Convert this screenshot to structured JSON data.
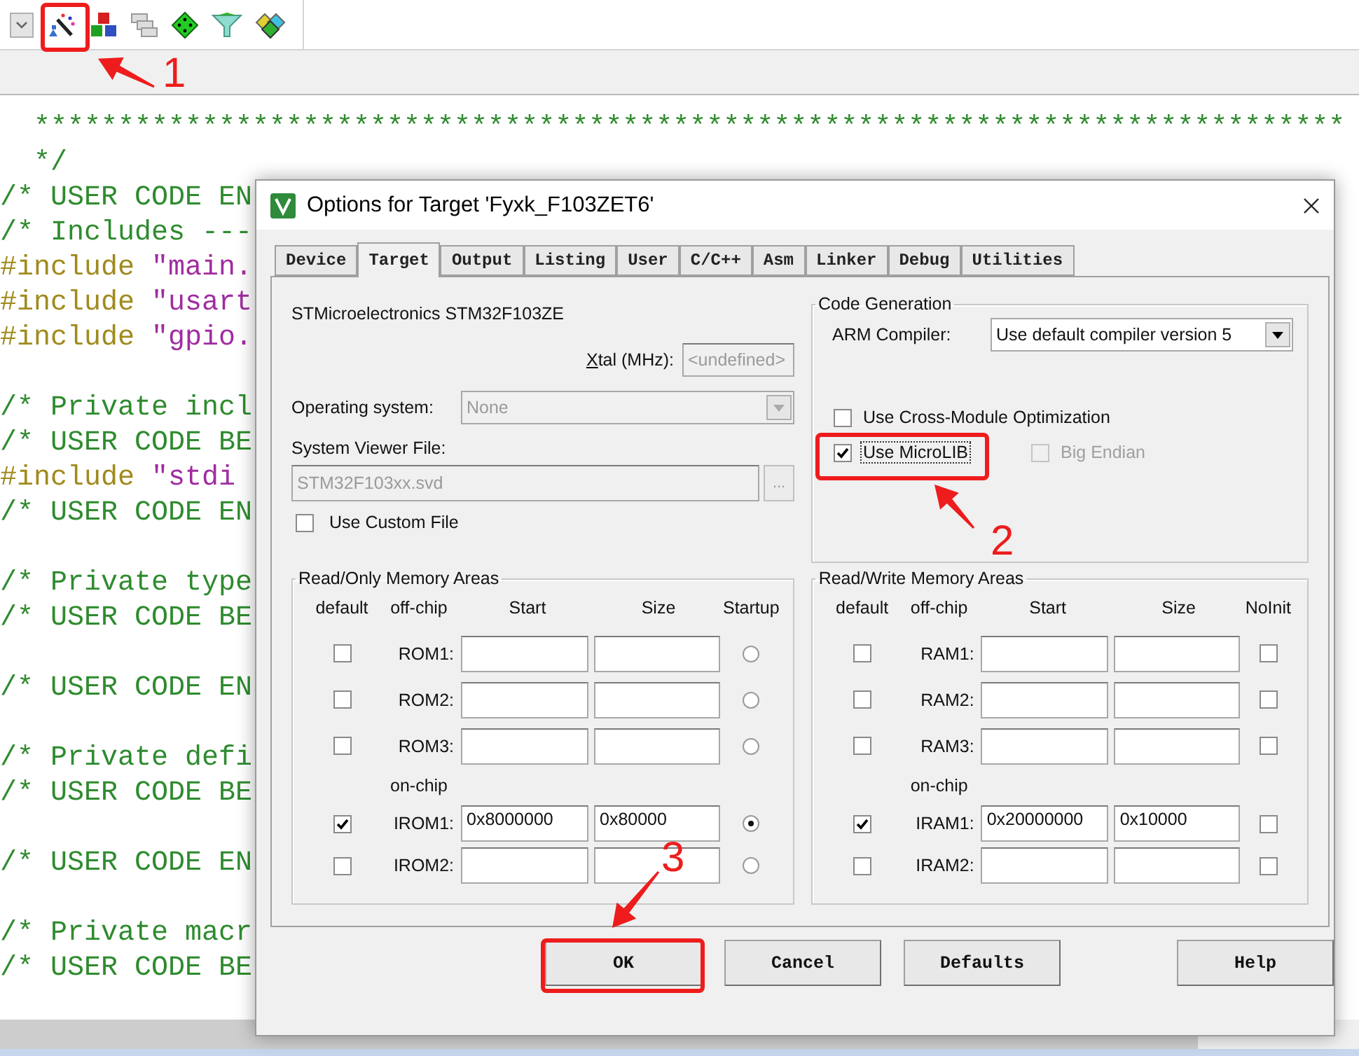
{
  "editor": {
    "lines": [
      {
        "kind": "comment",
        "text": "  ******************************************************************************"
      },
      {
        "kind": "comment",
        "text": "  */"
      },
      {
        "kind": "comment",
        "text": "/* USER CODE EN"
      },
      {
        "kind": "comment",
        "text": "/* Includes ---"
      },
      {
        "kind": "include",
        "directive": "#include ",
        "string": "\"main."
      },
      {
        "kind": "include",
        "directive": "#include ",
        "string": "\"usart"
      },
      {
        "kind": "include",
        "directive": "#include ",
        "string": "\"gpio."
      },
      {
        "kind": "blank"
      },
      {
        "kind": "comment",
        "text": "/* Private incl"
      },
      {
        "kind": "comment",
        "text": "/* USER CODE BE"
      },
      {
        "kind": "include",
        "directive": "#include ",
        "string": "\"stdi"
      },
      {
        "kind": "comment",
        "text": "/* USER CODE EN"
      },
      {
        "kind": "blank"
      },
      {
        "kind": "comment",
        "text": "/* Private type"
      },
      {
        "kind": "comment",
        "text": "/* USER CODE BE"
      },
      {
        "kind": "blank"
      },
      {
        "kind": "comment",
        "text": "/* USER CODE EN"
      },
      {
        "kind": "blank"
      },
      {
        "kind": "comment",
        "text": "/* Private defi"
      },
      {
        "kind": "comment",
        "text": "/* USER CODE BE"
      },
      {
        "kind": "blank"
      },
      {
        "kind": "comment",
        "text": "/* USER CODE EN"
      },
      {
        "kind": "blank"
      },
      {
        "kind": "comment",
        "text": "/* Private macr"
      },
      {
        "kind": "comment",
        "text": "/* USER CODE BE"
      }
    ]
  },
  "dialog": {
    "title": "Options for Target 'Fyxk_F103ZET6'",
    "tabs": [
      {
        "label": "Device",
        "selected": false
      },
      {
        "label": "Target",
        "selected": true
      },
      {
        "label": "Output",
        "selected": false
      },
      {
        "label": "Listing",
        "selected": false
      },
      {
        "label": "User",
        "selected": false
      },
      {
        "label": "C/C++",
        "selected": false
      },
      {
        "label": "Asm",
        "selected": false
      },
      {
        "label": "Linker",
        "selected": false
      },
      {
        "label": "Debug",
        "selected": false
      },
      {
        "label": "Utilities",
        "selected": false
      }
    ],
    "device": "STMicroelectronics STM32F103ZE",
    "xtal": {
      "label": "Xtal (MHz):",
      "value": "<undefined>"
    },
    "operating_system": {
      "label": "Operating system:",
      "value": "None",
      "disabled": true
    },
    "system_viewer_file": {
      "label": "System Viewer File:",
      "value": "STM32F103xx.svd",
      "disabled": true,
      "browse": "..."
    },
    "custom_file": {
      "label": "Use Custom File",
      "checked": false
    },
    "code_generation": {
      "legend": "Code Generation",
      "compiler_label": "ARM Compiler:",
      "compiler": "Use default compiler version 5",
      "options": [
        {
          "label": "Use Cross-Module Optimization",
          "checked": false,
          "disabled": false,
          "focused": false
        },
        {
          "label": "Use MicroLIB",
          "checked": true,
          "disabled": false,
          "focused": true
        },
        {
          "label": "Big Endian",
          "checked": false,
          "disabled": true,
          "focused": false
        }
      ]
    },
    "memory_groups": [
      {
        "kind": "rom",
        "legend": "Read/Only Memory Areas",
        "headers": [
          "default",
          "off-chip",
          "Start",
          "Size",
          "Startup"
        ],
        "on_chip_label": "on-chip",
        "off_chip_rows": [
          {
            "label": "ROM1:",
            "default": false,
            "startup": false
          },
          {
            "label": "ROM2:",
            "default": false,
            "startup": false
          },
          {
            "label": "ROM3:",
            "default": false,
            "startup": false
          }
        ],
        "on_chip_rows": [
          {
            "label": "IROM1:",
            "default": true,
            "start": "0x8000000",
            "size": "0x80000",
            "startup": true
          },
          {
            "label": "IROM2:",
            "default": false,
            "startup": false
          }
        ]
      },
      {
        "kind": "ram",
        "legend": "Read/Write Memory Areas",
        "headers": [
          "default",
          "off-chip",
          "Start",
          "Size",
          "NoInit"
        ],
        "on_chip_label": "on-chip",
        "off_chip_rows": [
          {
            "label": "RAM1:",
            "default": false,
            "no_init": false
          },
          {
            "label": "RAM2:",
            "default": false,
            "no_init": false
          },
          {
            "label": "RAM3:",
            "default": false,
            "no_init": false
          }
        ],
        "on_chip_rows": [
          {
            "label": "IRAM1:",
            "default": true,
            "start": "0x20000000",
            "size": "0x10000",
            "no_init": false
          },
          {
            "label": "IRAM2:",
            "default": false,
            "no_init": false
          }
        ]
      }
    ],
    "buttons": [
      {
        "label": "OK"
      },
      {
        "label": "Cancel"
      },
      {
        "label": "Defaults"
      },
      {
        "label": "Help"
      }
    ]
  },
  "annotations": [
    {
      "number": "1"
    },
    {
      "number": "2"
    },
    {
      "number": "3"
    }
  ]
}
